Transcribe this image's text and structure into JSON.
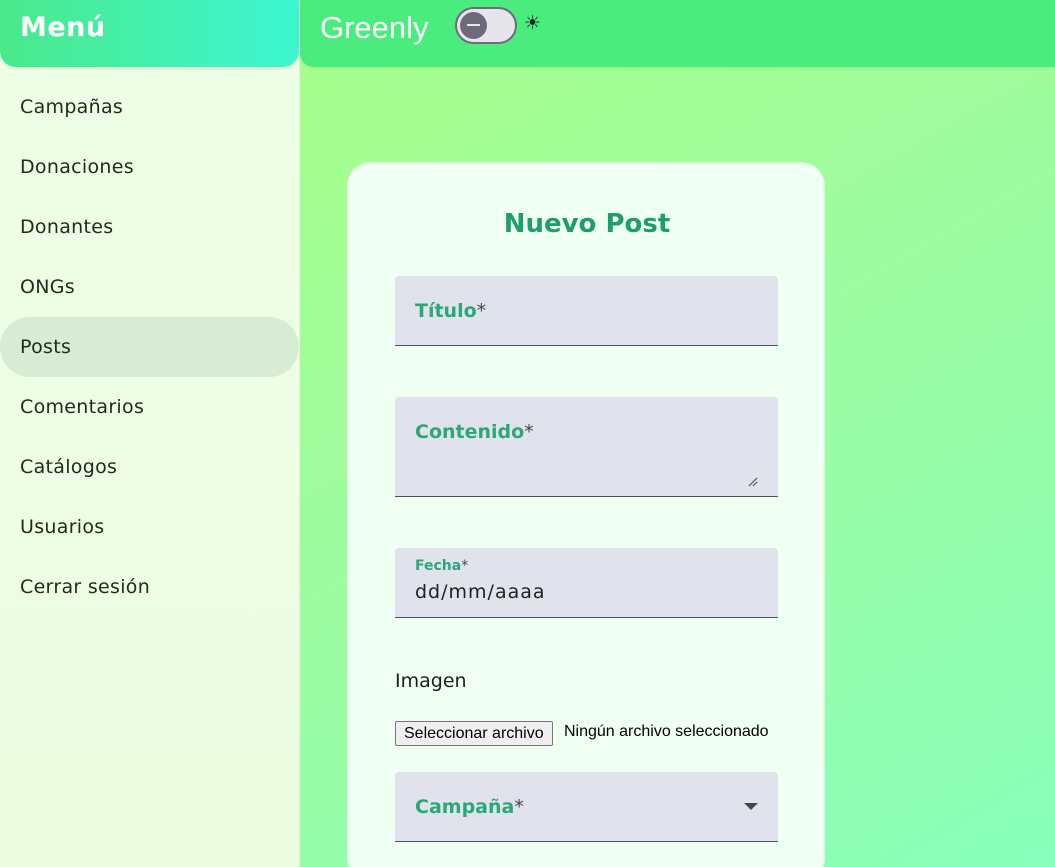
{
  "sidebar": {
    "title": "Menú",
    "items": [
      {
        "label": "Campañas"
      },
      {
        "label": "Donaciones"
      },
      {
        "label": "Donantes"
      },
      {
        "label": "ONGs"
      },
      {
        "label": "Posts",
        "active": true
      },
      {
        "label": "Comentarios"
      },
      {
        "label": "Catálogos"
      },
      {
        "label": "Usuarios"
      },
      {
        "label": "Cerrar sesión"
      }
    ]
  },
  "topbar": {
    "app_title": "Greenly",
    "theme_toggle_icon": "toggle-icon",
    "sun_icon": "sun-icon",
    "sun_glyph": "☀"
  },
  "form": {
    "title": "Nuevo Post",
    "titulo_label": "Título",
    "contenido_label": "Contenido",
    "fecha_label": "Fecha",
    "fecha_placeholder": "dd/mm/aaaa",
    "required_mark": "*",
    "imagen_label": "Imagen",
    "file_button_label": "Seleccionar archivo",
    "file_status": "Ningún archivo seleccionado",
    "campana_label": "Campaña"
  },
  "colors": {
    "accent": "#1f9e6d",
    "label_green": "#2ba879",
    "header_green": "#49ec7d",
    "field_bg": "#e0e3ec"
  }
}
